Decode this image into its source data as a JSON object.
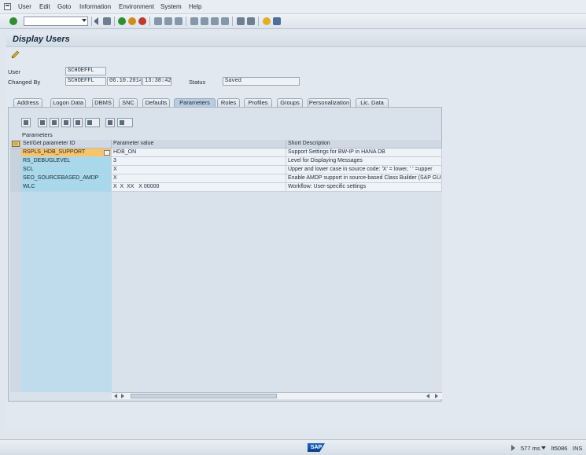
{
  "menu": [
    {
      "label": "User",
      "ul": "U",
      "rest": "ser"
    },
    {
      "label": "Edit",
      "ul": "E",
      "rest": "dit"
    },
    {
      "label": "Goto",
      "ul": "G",
      "rest": "oto"
    },
    {
      "label": "Information",
      "ul": "I",
      "rest": "nformation"
    },
    {
      "label": "Environment",
      "ul": "n",
      "pre": "E",
      "rest": "vironment"
    },
    {
      "label": "System",
      "ul": "y",
      "pre": "S",
      "rest": "stem"
    },
    {
      "label": "Help",
      "ul": "H",
      "rest": "elp"
    }
  ],
  "title": "Display Users",
  "header": {
    "user_label": "User",
    "user_value": "SCHOEFFL",
    "changed_by_label": "Changed By",
    "changed_by_value": "SCHOEFFL",
    "changed_date": "06.10.2014",
    "changed_time": "13:38:42",
    "status_label": "Status",
    "status_value": "Saved"
  },
  "tabs": [
    "Address",
    "Logon Data",
    "DBMS",
    "SNC",
    "Defaults",
    "Parameters",
    "Roles",
    "Profiles",
    "Groups",
    "Personalization",
    "Lic. Data"
  ],
  "active_tab": "Parameters",
  "parameters": {
    "caption": "Parameters",
    "columns": {
      "id": "Set/Get parameter ID",
      "value": "Parameter value",
      "desc": "Short Description"
    },
    "rows": [
      {
        "id": "RSPLS_HDB_SUPPORT",
        "value": "HDB_ON",
        "desc": "Support Settings for BW-IP in HANA DB"
      },
      {
        "id": "RS_DEBUGLEVEL",
        "value": "3",
        "desc": "Level for Displaying Messages"
      },
      {
        "id": "SCL",
        "value": "X",
        "desc": "Upper and lower case in source code: 'X' = lower, ' ' =upper"
      },
      {
        "id": "SEO_SOURCEBASED_AMDP",
        "value": "X",
        "desc": "Enable AMDP support in source-based Class Builder (SAP GUI)"
      },
      {
        "id": "WLC",
        "value": "X  X  XX   X 00000",
        "desc": "Workflow: User-specific settings"
      }
    ]
  },
  "statusbar": {
    "logo": "SAP",
    "response_time": "577 ms",
    "server": "lt5086",
    "mode": "INS"
  }
}
